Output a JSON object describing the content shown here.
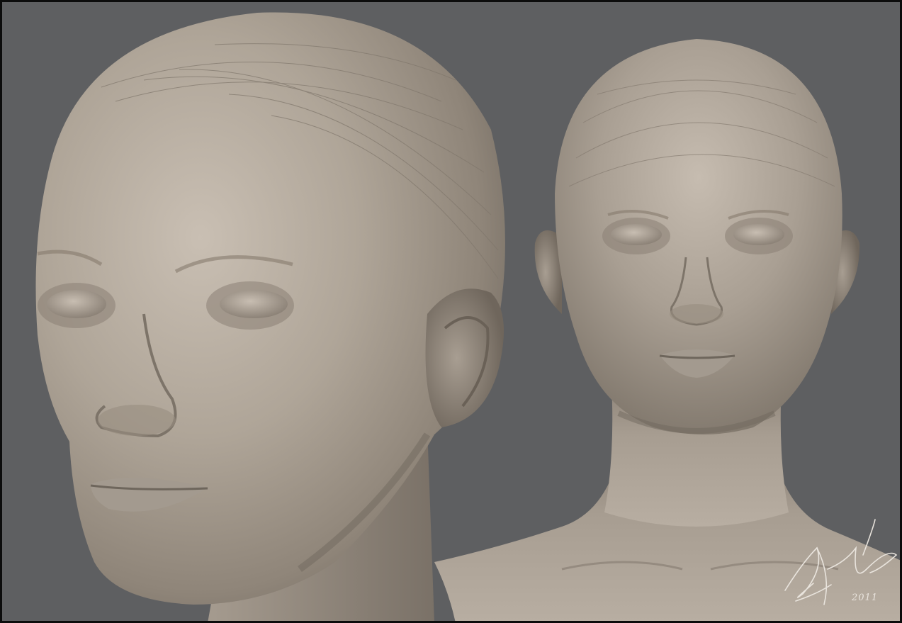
{
  "artwork": {
    "background_color": "#5e5f61",
    "sculpt_color": "#a69c90",
    "views": [
      {
        "name": "three-quarter-head-closeup"
      },
      {
        "name": "front-bust-view"
      }
    ],
    "signature": {
      "text": "",
      "year": "2011"
    }
  }
}
